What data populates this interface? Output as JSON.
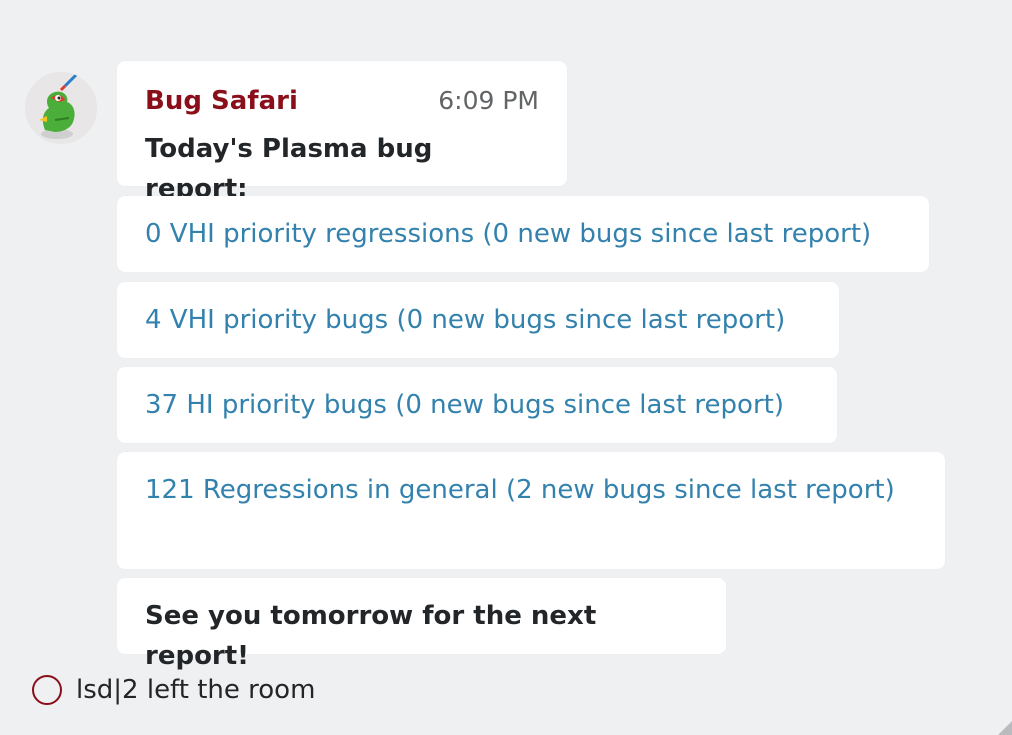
{
  "message": {
    "sender": "Bug Safari",
    "time": "6:09 PM",
    "heading": "Today's Plasma bug report:",
    "items": [
      "0 VHI priority regressions (0 new bugs since last report)",
      "4 VHI priority bugs (0 new bugs since last report)",
      "37 HI priority bugs (0 new bugs since last report)",
      "121 Regressions in general (2 new bugs since last report)"
    ],
    "footer": "See you tomorrow for the next report!"
  },
  "event": {
    "text": "lsd|2 left the room"
  },
  "colors": {
    "sender": "#8a0f1b",
    "link": "#3382ad",
    "background": "#eff0f1"
  }
}
